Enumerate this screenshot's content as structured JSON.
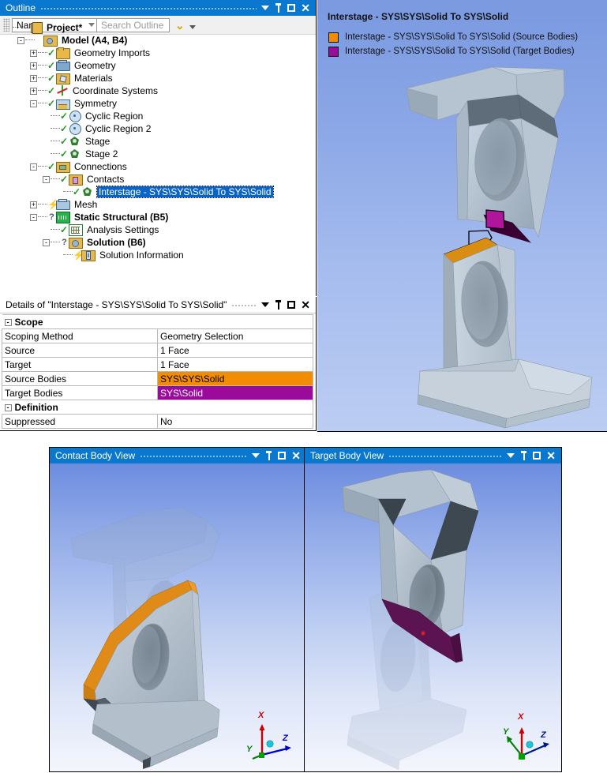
{
  "outline": {
    "title": "Outline",
    "toolbar": {
      "filter_value": "Name",
      "search_placeholder": "Search Outline",
      "expand_icon": "chevron-down-icon",
      "more_icon": "caret-down-icon"
    },
    "window_buttons": [
      "caret-down-icon",
      "pin-icon",
      "maximize-icon",
      "close-icon"
    ],
    "tree": [
      {
        "label": "Project*",
        "depth": 0,
        "icon": "project-icon",
        "expander": "",
        "state": "",
        "bold": true,
        "selected": false
      },
      {
        "label": "Model (A4, B4)",
        "depth": 1,
        "icon": "model-icon",
        "expander": "-",
        "state": "",
        "bold": true,
        "selected": false
      },
      {
        "label": "Geometry Imports",
        "depth": 2,
        "icon": "geometry-imports-icon",
        "expander": "+",
        "state": "check",
        "bold": false,
        "selected": false
      },
      {
        "label": "Geometry",
        "depth": 2,
        "icon": "geometry-icon",
        "expander": "+",
        "state": "check",
        "bold": false,
        "selected": false
      },
      {
        "label": "Materials",
        "depth": 2,
        "icon": "materials-icon",
        "expander": "+",
        "state": "check",
        "bold": false,
        "selected": false
      },
      {
        "label": "Coordinate Systems",
        "depth": 2,
        "icon": "coordinate-systems-icon",
        "expander": "+",
        "state": "check",
        "bold": false,
        "selected": false
      },
      {
        "label": "Symmetry",
        "depth": 2,
        "icon": "symmetry-icon",
        "expander": "-",
        "state": "check",
        "bold": false,
        "selected": false
      },
      {
        "label": "Cyclic Region",
        "depth": 3,
        "icon": "cyclic-region-icon",
        "expander": "",
        "state": "check",
        "bold": false,
        "selected": false
      },
      {
        "label": "Cyclic Region 2",
        "depth": 3,
        "icon": "cyclic-region-icon",
        "expander": "",
        "state": "check",
        "bold": false,
        "selected": false
      },
      {
        "label": "Stage",
        "depth": 3,
        "icon": "stage-icon",
        "expander": "",
        "state": "check",
        "bold": false,
        "selected": false
      },
      {
        "label": "Stage 2",
        "depth": 3,
        "icon": "stage-icon",
        "expander": "",
        "state": "check",
        "bold": false,
        "selected": false
      },
      {
        "label": "Connections",
        "depth": 2,
        "icon": "connections-icon",
        "expander": "-",
        "state": "check",
        "bold": false,
        "selected": false
      },
      {
        "label": "Contacts",
        "depth": 3,
        "icon": "contacts-icon",
        "expander": "-",
        "state": "check",
        "bold": false,
        "selected": false
      },
      {
        "label": "Interstage - SYS\\SYS\\Solid To SYS\\Solid",
        "depth": 4,
        "icon": "contact-region-icon",
        "expander": "",
        "state": "check",
        "bold": false,
        "selected": true
      },
      {
        "label": "Mesh",
        "depth": 2,
        "icon": "mesh-icon",
        "expander": "+",
        "state": "lightning",
        "bold": false,
        "selected": false
      },
      {
        "label": "Static Structural (B5)",
        "depth": 2,
        "icon": "static-structural-icon",
        "expander": "-",
        "state": "question",
        "bold": true,
        "selected": false
      },
      {
        "label": "Analysis Settings",
        "depth": 3,
        "icon": "analysis-settings-icon",
        "expander": "",
        "state": "check",
        "bold": false,
        "selected": false
      },
      {
        "label": "Solution (B6)",
        "depth": 3,
        "icon": "solution-icon",
        "expander": "-",
        "state": "question",
        "bold": true,
        "selected": false
      },
      {
        "label": "Solution Information",
        "depth": 4,
        "icon": "solution-information-icon",
        "expander": "",
        "state": "lightning",
        "bold": false,
        "selected": false
      }
    ]
  },
  "details": {
    "title": "Details of \"Interstage - SYS\\SYS\\Solid To SYS\\Solid\"",
    "window_buttons": [
      "caret-down-icon",
      "pin-icon",
      "maximize-icon",
      "close-icon"
    ],
    "rows": [
      {
        "type": "header",
        "label": "Scope",
        "collapse": "-"
      },
      {
        "type": "prop",
        "key": "Scoping Method",
        "value": "Geometry Selection",
        "style": ""
      },
      {
        "type": "prop",
        "key": "Source",
        "value": "1 Face",
        "style": ""
      },
      {
        "type": "prop",
        "key": "Target",
        "value": "1 Face",
        "style": ""
      },
      {
        "type": "prop",
        "key": "Source Bodies",
        "value": "SYS\\SYS\\Solid",
        "style": "orange"
      },
      {
        "type": "prop",
        "key": "Target Bodies",
        "value": "SYS\\Solid",
        "style": "magenta"
      },
      {
        "type": "header",
        "label": "Definition",
        "collapse": "-"
      },
      {
        "type": "prop",
        "key": "Suppressed",
        "value": "No",
        "style": ""
      }
    ]
  },
  "main_viewport": {
    "title": "Interstage - SYS\\SYS\\Solid To SYS\\Solid",
    "legend": [
      {
        "color": "#f28c00",
        "label": "Interstage - SYS\\SYS\\Solid To SYS\\Solid (Source Bodies)"
      },
      {
        "color": "#9b0b9b",
        "label": "Interstage - SYS\\SYS\\Solid To SYS\\Solid (Target Bodies)"
      }
    ]
  },
  "contact_body_view": {
    "title": "Contact Body View",
    "window_buttons": [
      "caret-down-icon",
      "pin-icon",
      "maximize-icon",
      "close-icon"
    ],
    "triad": {
      "x": "X",
      "y": "Y",
      "z": "Z"
    }
  },
  "target_body_view": {
    "title": "Target Body View",
    "window_buttons": [
      "caret-down-icon",
      "pin-icon",
      "maximize-icon",
      "close-icon"
    ],
    "triad": {
      "x": "X",
      "y": "Y",
      "z": "Z"
    }
  },
  "colors": {
    "accent": "#0b78d0",
    "source_bodies": "#f28c00",
    "target_bodies": "#9b0b9b",
    "selection": "#0a64c8"
  }
}
